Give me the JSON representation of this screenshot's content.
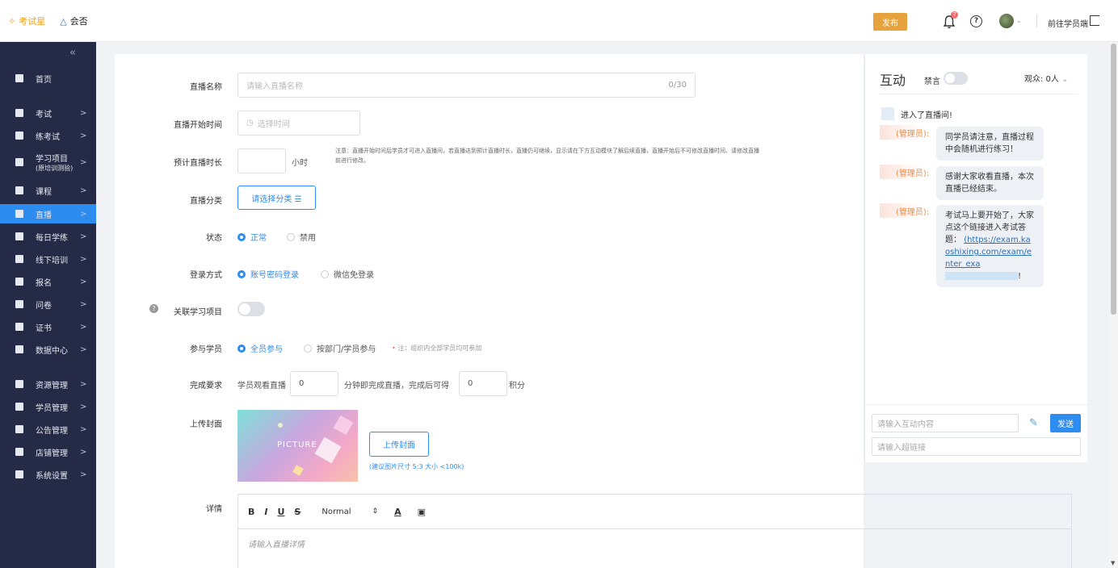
{
  "header": {
    "logo_kaoshixing": "考试星",
    "logo_huibei": "会否",
    "publish": "发布",
    "notification_count": "7",
    "help": "?",
    "front_link": "前往学员端"
  },
  "sidebar": {
    "collapse": "«",
    "items": [
      {
        "label": "首页",
        "sub": "",
        "icon": "home-grid-icon"
      },
      {
        "label": "考试",
        "sub": "",
        "icon": "exam-icon"
      },
      {
        "label": "练考试",
        "sub": "",
        "icon": "practice-icon"
      },
      {
        "label": "学习项目",
        "sub": "(原培训测验)",
        "icon": "learning-project-icon"
      },
      {
        "label": "课程",
        "sub": "",
        "icon": "book-icon"
      },
      {
        "label": "直播",
        "sub": "",
        "icon": "live-icon"
      },
      {
        "label": "每日学练",
        "sub": "",
        "icon": "daily-icon"
      },
      {
        "label": "线下培训",
        "sub": "",
        "icon": "offline-icon"
      },
      {
        "label": "报名",
        "sub": "",
        "icon": "signup-icon"
      },
      {
        "label": "问卷",
        "sub": "",
        "icon": "survey-icon"
      },
      {
        "label": "证书",
        "sub": "",
        "icon": "certificate-icon"
      },
      {
        "label": "数据中心",
        "sub": "",
        "icon": "chart-icon"
      },
      {
        "label": "资源管理",
        "sub": "",
        "icon": "folder-icon"
      },
      {
        "label": "学员管理",
        "sub": "",
        "icon": "user-icon"
      },
      {
        "label": "公告管理",
        "sub": "",
        "icon": "announce-icon"
      },
      {
        "label": "店铺管理",
        "sub": "",
        "icon": "shop-icon"
      },
      {
        "label": "系统设置",
        "sub": "",
        "icon": "gear-icon"
      }
    ],
    "arrow": ">"
  },
  "form": {
    "live_name_label": "直播名称",
    "live_name_placeholder": "请输入直播名称",
    "live_name_count": "0/30",
    "start_time_label": "直播开始时间",
    "start_time_placeholder": "选择时间",
    "duration_label": "预计直播时长",
    "duration_unit": "小时",
    "duration_note": "注意：直播开始时间后学员才可进入直播间，若直播达到预计直播时长，直播仍可继续，显示请在下方互动模块了解后续直播，直播开始后不可修改直播时间、请修改直播前进行修改。",
    "category_label": "直播分类",
    "category_button": "请选择分类 ☰",
    "status_label": "状态",
    "status_normal": "正常",
    "status_disabled": "禁用",
    "login_label": "登录方式",
    "login_account": "账号密码登录",
    "login_wechat": "微信免登录",
    "link_project_label": "关联学习项目",
    "participants_label": "参与学员",
    "participants_all": "全员参与",
    "participants_dept": "按部门/学员参与",
    "participants_note": "注：组织内全部学员均可参加",
    "complete_label": "完成要求",
    "complete_prefix": "学员观看直播",
    "complete_minutes": "0",
    "complete_middle": "分钟即完成直播，完成后可得",
    "complete_points": "0",
    "complete_suffix": "积分",
    "cover_label": "上传封面",
    "cover_picture_text": "PICTURE",
    "cover_upload": "上传封面",
    "cover_hint": "(建议图片尺寸 5:3 大小 <100k)",
    "detail_label": "详情",
    "editor_format": "Normal",
    "editor_placeholder": "请输入直播详情"
  },
  "chat": {
    "title": "互动",
    "mute_label": "禁言",
    "viewers": "观众: 0人",
    "system_message": "进入了直播间!",
    "messages": [
      {
        "who": "(管理员):",
        "text": "同学员请注意，直播过程中会随机进行练习！"
      },
      {
        "who": "(管理员):",
        "text": "感谢大家收看直播，本次直播已经结束。"
      },
      {
        "who": "(管理员):",
        "text": "考试马上要开始了，大家点这个链接进入考试答题：",
        "link": "(https://exam.kaoshixing.com/exam/enter_exa",
        "link_tail": "!"
      }
    ],
    "input_placeholder": "请输入互动内容",
    "link_placeholder": "请输入超链接",
    "send": "发送"
  }
}
